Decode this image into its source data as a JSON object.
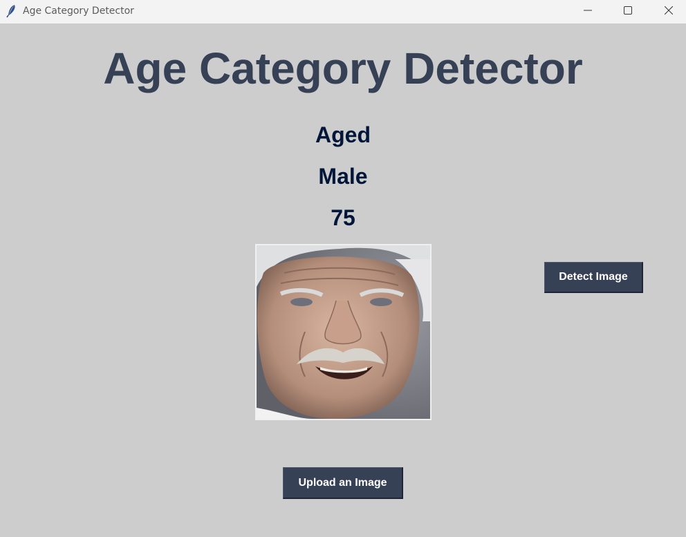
{
  "window": {
    "title": "Age Category Detector",
    "app_icon": "feather-icon",
    "controls": [
      "minimize-icon",
      "maximize-icon",
      "close-icon"
    ]
  },
  "main": {
    "heading": "Age Category Detector",
    "result": {
      "category": "Aged",
      "gender": "Male",
      "age": "75"
    },
    "image": {
      "description_icon": "face-photo"
    },
    "buttons": {
      "detect_label": "Detect Image",
      "upload_label": "Upload an Image"
    }
  },
  "colors": {
    "background": "#cdcdcd",
    "heading": "#364156",
    "result_text": "#011638",
    "button_bg": "#364156",
    "button_text": "#ffffff"
  }
}
